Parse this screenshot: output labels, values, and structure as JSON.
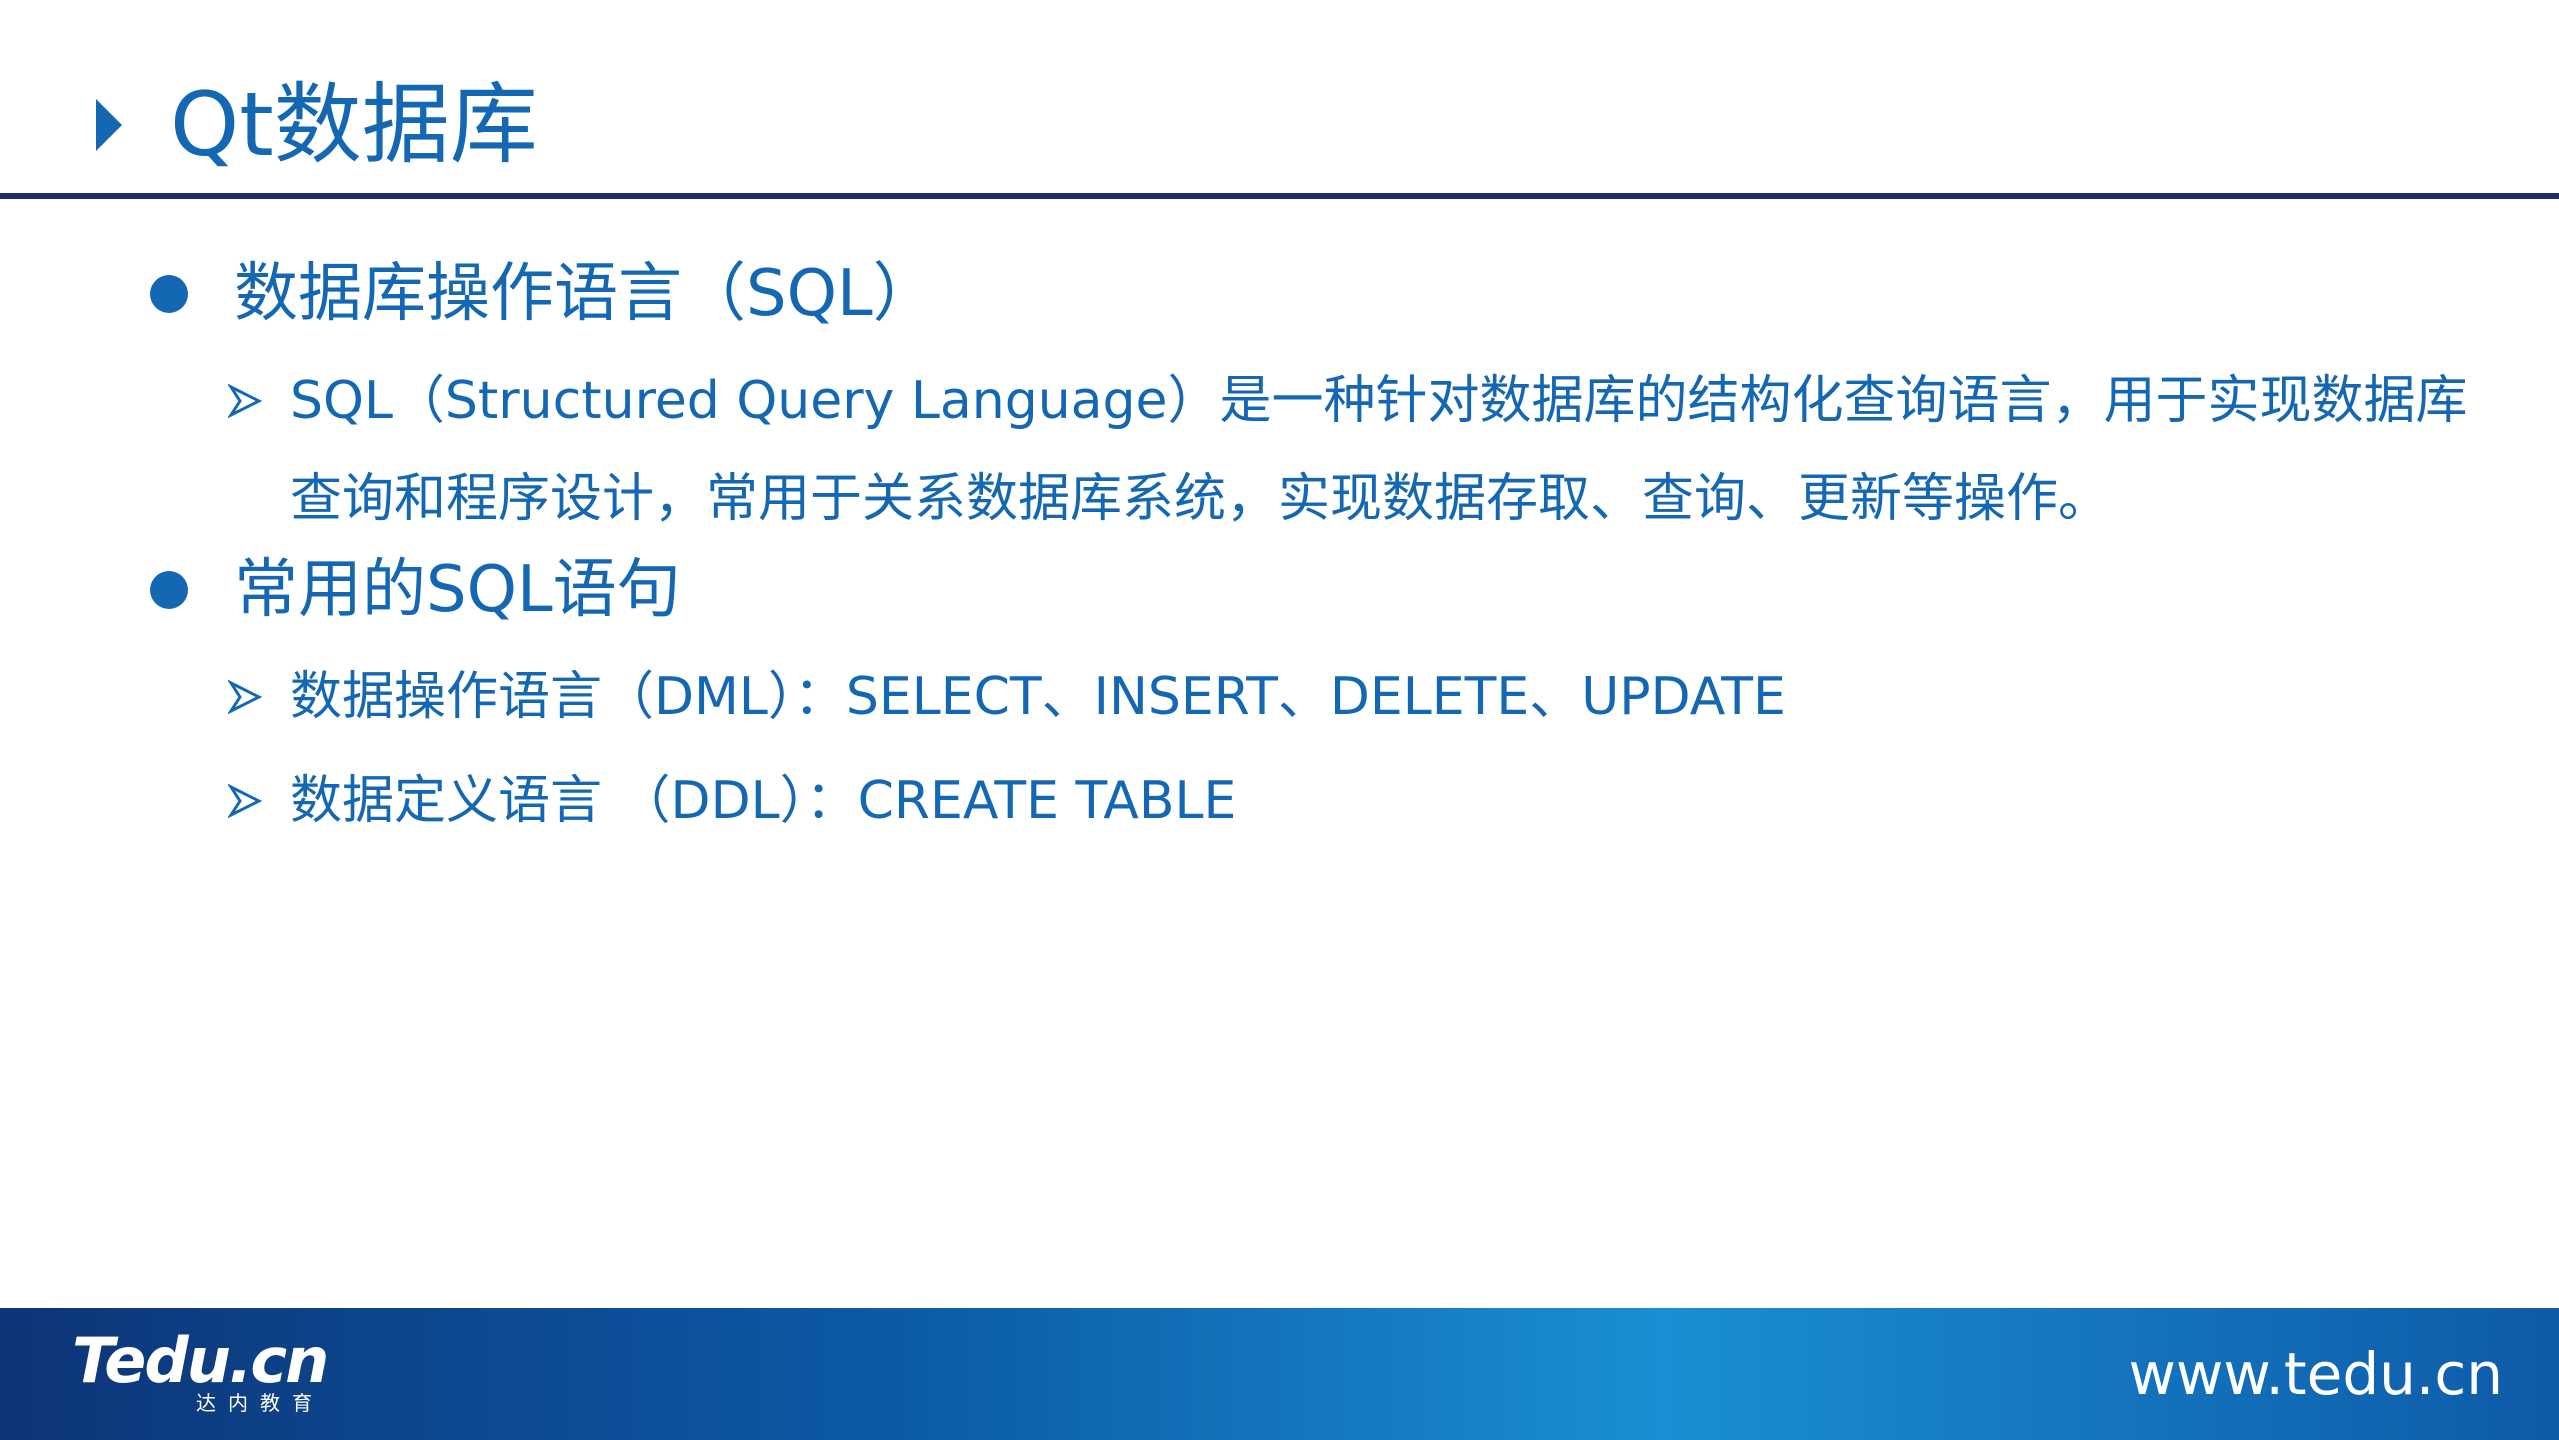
{
  "colors": {
    "accent": "#1468b3",
    "rule": "#1f2f6e",
    "footer_start": "#0d3577",
    "footer_mid": "#1a8fd4"
  },
  "title": {
    "text": "Qt数据库",
    "marker_icon": "triangle-right-icon"
  },
  "sections": [
    {
      "heading": "数据库操作语言（SQL）",
      "bullet_icon": "filled-circle-icon",
      "items": [
        {
          "arrow_icon": "arrow-bullet-icon",
          "text": "SQL（Structured Query Language）是一种针对数据库的结构化查询语言，用于实现数据库查询和程序设计，常用于关系数据库系统，实现数据存取、查询、更新等操作。"
        }
      ]
    },
    {
      "heading": "常用的SQL语句",
      "bullet_icon": "filled-circle-icon",
      "items": [
        {
          "arrow_icon": "arrow-bullet-icon",
          "text": "数据操作语言（DML）：SELECT、INSERT、DELETE、UPDATE"
        },
        {
          "arrow_icon": "arrow-bullet-icon",
          "text": "数据定义语言 （DDL）：CREATE TABLE"
        }
      ]
    }
  ],
  "footer": {
    "logo_brand": "Tedu.cn",
    "logo_sub": "达内教育",
    "url": "www.tedu.cn"
  }
}
